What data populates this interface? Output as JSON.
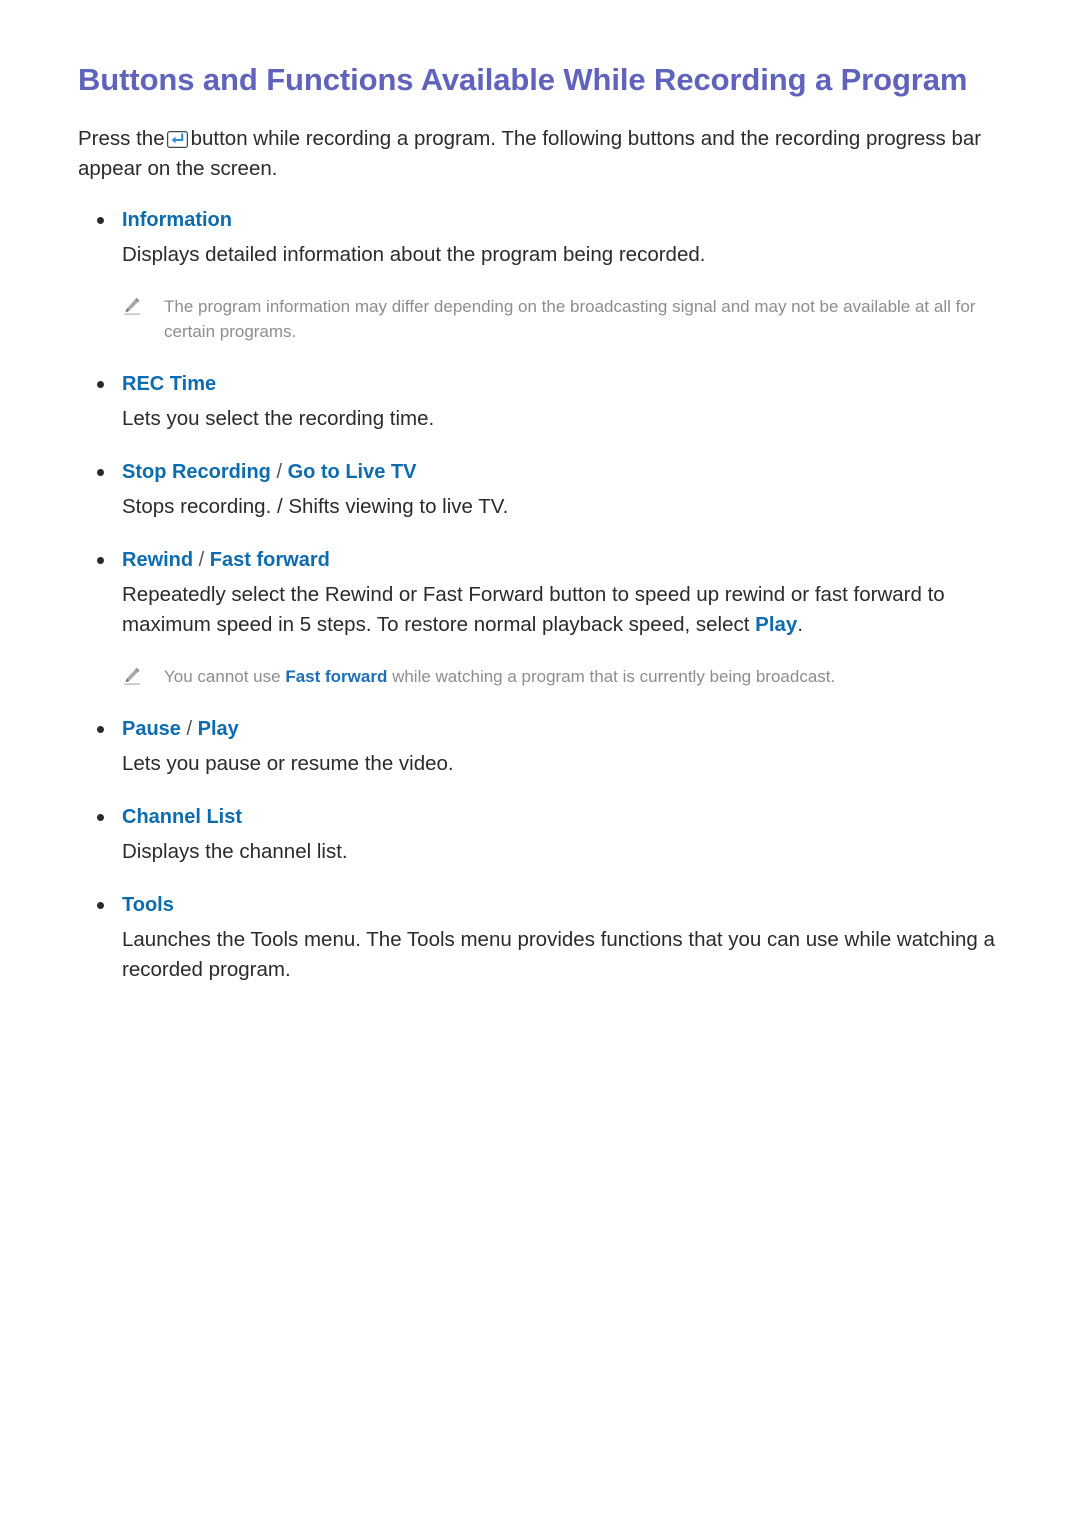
{
  "document": {
    "title": "Buttons and Functions Available While Recording a Program",
    "intro": {
      "before_icon": "Press the",
      "icon": "enter-button-icon",
      "after_icon": "button while recording a program. The following buttons and the recording progress bar appear on the screen."
    }
  },
  "colors": {
    "title": "#5f63bc",
    "heading_blue": "#0d6cb0",
    "body": "#2b2b2b",
    "note_gray": "#8d8d8d",
    "note_keyword_blue": "#1d6fb8"
  },
  "sections": [
    {
      "label": "Information",
      "label_parts": [
        {
          "text": "Information",
          "style": "blue"
        }
      ],
      "description": "Displays detailed information about the program being recorded.",
      "note": {
        "icon": "pencil-icon",
        "parts": [
          {
            "text": "The program information may differ depending on the broadcasting signal and may not be available at all for certain programs.",
            "style": "gray"
          }
        ]
      }
    },
    {
      "label": "REC Time",
      "label_parts": [
        {
          "text": "REC Time",
          "style": "blue"
        }
      ],
      "description": "Lets you select the recording time.",
      "note": null
    },
    {
      "label": "Stop Recording / Go to Live TV",
      "label_parts": [
        {
          "text": "Stop Recording",
          "style": "blue"
        },
        {
          "text": " / ",
          "style": "sep"
        },
        {
          "text": "Go to Live TV",
          "style": "blue"
        }
      ],
      "description": "Stops recording. / Shifts viewing to live TV.",
      "note": null
    },
    {
      "label": "Rewind / Fast forward",
      "label_parts": [
        {
          "text": "Rewind",
          "style": "blue"
        },
        {
          "text": " / ",
          "style": "sep"
        },
        {
          "text": "Fast forward",
          "style": "blue"
        }
      ],
      "description_parts": [
        {
          "text": "Repeatedly select the Rewind or Fast Forward button to speed up rewind or fast forward to maximum speed in 5 steps. To restore normal playback speed, select ",
          "style": "body"
        },
        {
          "text": "Play",
          "style": "keyword"
        },
        {
          "text": ".",
          "style": "body"
        }
      ],
      "note": {
        "icon": "pencil-icon",
        "parts": [
          {
            "text": "You cannot use ",
            "style": "gray"
          },
          {
            "text": "Fast forward",
            "style": "keyword"
          },
          {
            "text": " while watching a program that is currently being broadcast.",
            "style": "gray"
          }
        ]
      }
    },
    {
      "label": "Pause / Play",
      "label_parts": [
        {
          "text": "Pause",
          "style": "blue"
        },
        {
          "text": " / ",
          "style": "sep"
        },
        {
          "text": "Play",
          "style": "blue"
        }
      ],
      "description": "Lets you pause or resume the video.",
      "note": null
    },
    {
      "label": "Channel List",
      "label_parts": [
        {
          "text": "Channel List",
          "style": "blue"
        }
      ],
      "description": "Displays the channel list.",
      "note": null
    },
    {
      "label": "Tools",
      "label_parts": [
        {
          "text": "Tools",
          "style": "blue"
        }
      ],
      "description": "Launches the Tools menu. The Tools menu provides functions that you can use while watching a recorded program.",
      "note": null
    }
  ]
}
